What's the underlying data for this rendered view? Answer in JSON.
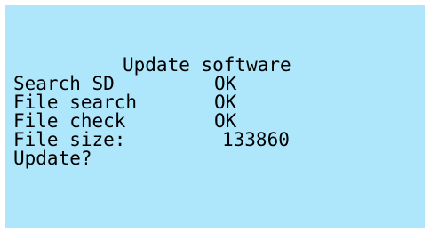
{
  "screen": {
    "title": "Update software",
    "rows": [
      {
        "label": "Search SD",
        "value": "OK"
      },
      {
        "label": "File search",
        "value": "OK"
      },
      {
        "label": "File check",
        "value": "OK"
      },
      {
        "label": "File size:",
        "value": "133860"
      }
    ],
    "prompt": "Update?"
  },
  "colors": {
    "background": "#aee6fb",
    "text": "#000000"
  }
}
